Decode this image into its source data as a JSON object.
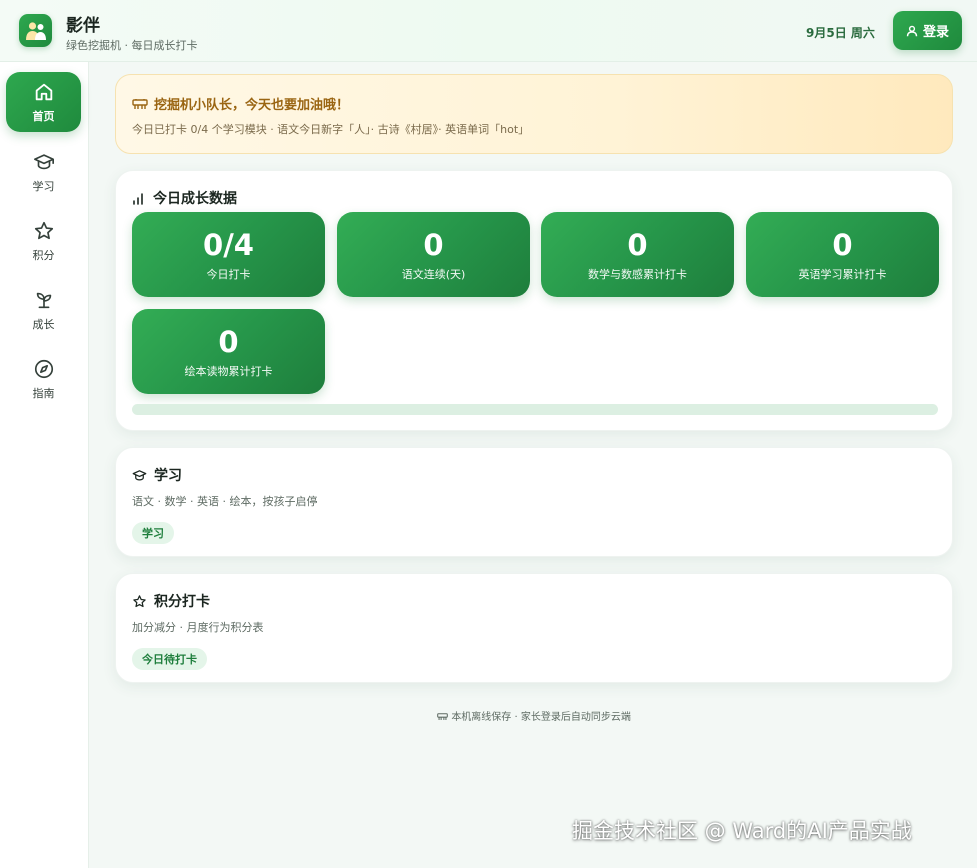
{
  "header": {
    "app_title": "影伴",
    "app_subtitle": "绿色挖掘机 · 每日成长打卡",
    "date": "9月5日 周六",
    "login_label": "登录"
  },
  "sidebar": {
    "items": [
      {
        "label": "首页",
        "icon": "home-icon",
        "active": true
      },
      {
        "label": "学习",
        "icon": "graduation-cap-icon",
        "active": false
      },
      {
        "label": "积分",
        "icon": "star-icon",
        "active": false
      },
      {
        "label": "成长",
        "icon": "sprout-icon",
        "active": false
      },
      {
        "label": "指南",
        "icon": "compass-icon",
        "active": false
      }
    ]
  },
  "banner": {
    "title": "挖掘机小队长，今天也要加油哦！",
    "subtitle": "今日已打卡 0/4 个学习模块 · 语文今日新字「人」· 古诗《村居》· 英语单词「hot」"
  },
  "stats_card": {
    "title": "今日成长数据",
    "stats": [
      {
        "value": "0/4",
        "label": "今日打卡"
      },
      {
        "value": "0",
        "label": "语文连续(天)"
      },
      {
        "value": "0",
        "label": "数学与数感累计打卡"
      },
      {
        "value": "0",
        "label": "英语学习累计打卡"
      },
      {
        "value": "0",
        "label": "绘本读物累计打卡"
      }
    ],
    "progress_fraction": 0
  },
  "study_card": {
    "title": "学习",
    "description": "语文 · 数学 · 英语 · 绘本，按孩子启停",
    "pill": "学习"
  },
  "points_card": {
    "title": "积分打卡",
    "description": "加分减分 · 月度行为积分表",
    "pill": "今日待打卡"
  },
  "footer": "本机离线保存 · 家长登录后自动同步云端",
  "watermark": "掘金技术社区 @ Ward的AI产品实战",
  "colors": {
    "accent": "#2ea84f",
    "accent_dark": "#1e7e3c",
    "banner_text": "#9a6512"
  }
}
